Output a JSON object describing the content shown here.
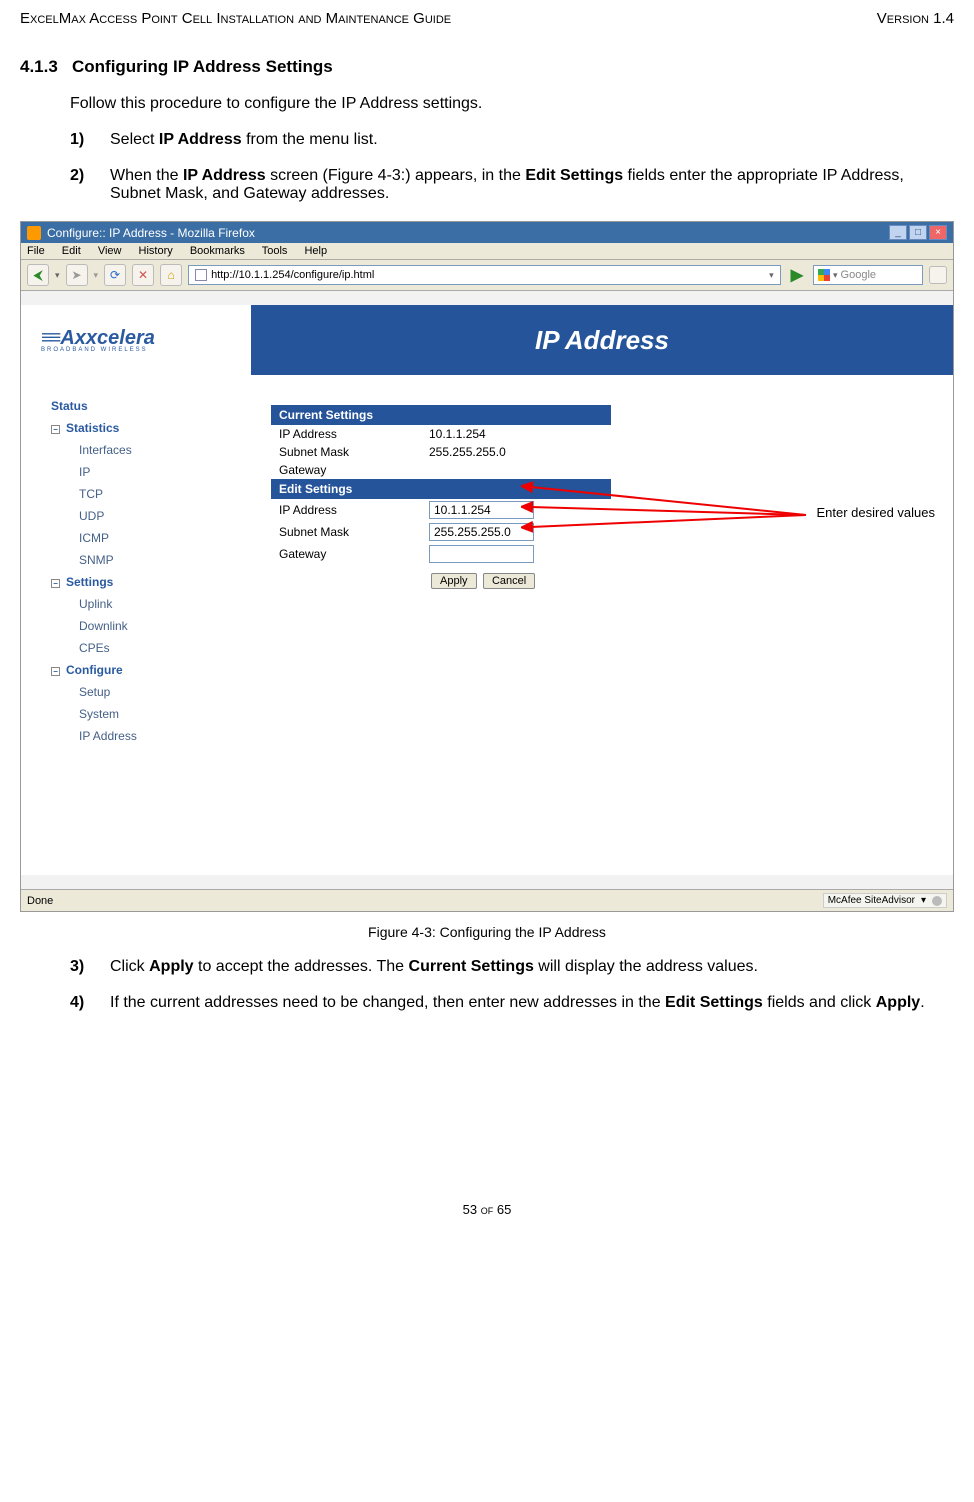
{
  "header": {
    "left": "ExcelMax Access Point Cell Installation and Maintenance Guide",
    "right": "Version 1.4"
  },
  "section": {
    "number": "4.1.3",
    "title": "Configuring IP Address Settings",
    "intro": "Follow this procedure to configure the IP Address settings.",
    "steps": [
      {
        "n": "1)",
        "pre": "Select ",
        "bold1": "IP Address",
        "post": " from the menu list."
      },
      {
        "n": "2)",
        "pre": "When the ",
        "bold1": "IP Address",
        "mid1": " screen (Figure 4-3:) appears, in the ",
        "bold2": "Edit Settings",
        "post": " fields enter the appropriate IP Address, Subnet Mask, and Gateway addresses."
      }
    ],
    "steps_after": [
      {
        "n": "3)",
        "pre": "Click ",
        "bold1": "Apply",
        "mid1": " to accept the addresses. The ",
        "bold2": "Current Settings",
        "post": " will display the address values."
      },
      {
        "n": "4)",
        "pre": "If the current addresses need to be changed, then enter new addresses in the ",
        "bold1": "Edit Settings",
        "mid1": " fields and click ",
        "bold2": "Apply",
        "post": "."
      }
    ]
  },
  "figure": {
    "caption": "Figure 4-3: Configuring the IP Address"
  },
  "browser": {
    "title": "Configure:: IP Address - Mozilla Firefox",
    "menu": [
      "File",
      "Edit",
      "View",
      "History",
      "Bookmarks",
      "Tools",
      "Help"
    ],
    "url": "http://10.1.1.254/configure/ip.html",
    "search_placeholder": "Google",
    "status_left": "Done",
    "status_right": "McAfee SiteAdvisor"
  },
  "app": {
    "logo_main": "Axxcelera",
    "logo_sub": "BROADBAND WIRELESS",
    "page_title": "IP Address",
    "nav": {
      "status": "Status",
      "statistics": "Statistics",
      "stat_items": [
        "Interfaces",
        "IP",
        "TCP",
        "UDP",
        "ICMP",
        "SNMP"
      ],
      "settings": "Settings",
      "settings_items": [
        "Uplink",
        "Downlink",
        "CPEs"
      ],
      "configure": "Configure",
      "configure_items": [
        "Setup",
        "System",
        "IP Address"
      ]
    },
    "current": {
      "header": "Current Settings",
      "rows": [
        {
          "label": "IP Address",
          "value": "10.1.1.254"
        },
        {
          "label": "Subnet Mask",
          "value": "255.255.255.0"
        },
        {
          "label": "Gateway",
          "value": ""
        }
      ]
    },
    "edit": {
      "header": "Edit Settings",
      "rows": [
        {
          "label": "IP Address",
          "value": "10.1.1.254"
        },
        {
          "label": "Subnet Mask",
          "value": "255.255.255.0"
        },
        {
          "label": "Gateway",
          "value": ""
        }
      ],
      "apply": "Apply",
      "cancel": "Cancel"
    },
    "annotation": "Enter desired values"
  },
  "footer": {
    "page": "53 of 65"
  }
}
